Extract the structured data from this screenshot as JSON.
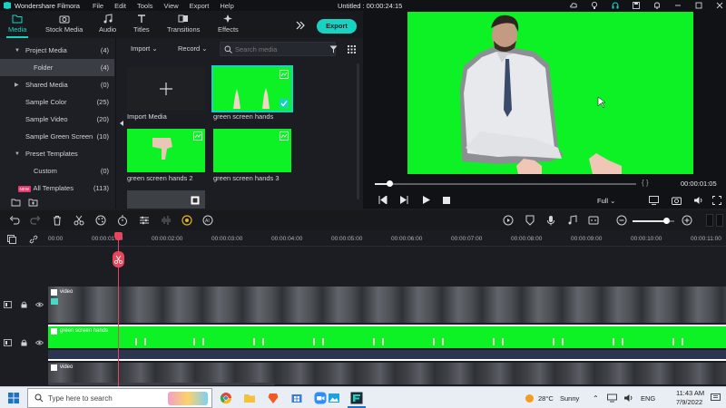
{
  "app": {
    "name": "Wondershare Filmora",
    "menu": [
      "File",
      "Edit",
      "Tools",
      "View",
      "Export",
      "Help"
    ],
    "document_title": "Untitled : 00:00:24:15"
  },
  "tabs": [
    {
      "label": "Media",
      "icon": "folder-icon"
    },
    {
      "label": "Stock Media",
      "icon": "camera-icon"
    },
    {
      "label": "Audio",
      "icon": "music-note-icon"
    },
    {
      "label": "Titles",
      "icon": "text-icon"
    },
    {
      "label": "Transitions",
      "icon": "transitions-icon"
    },
    {
      "label": "Effects",
      "icon": "effects-icon"
    }
  ],
  "export_label": "Export",
  "sidebar": {
    "items": [
      {
        "label": "Project Media",
        "count": "(4)",
        "caret": "▼"
      },
      {
        "label": "Folder",
        "count": "(4)"
      },
      {
        "label": "Shared Media",
        "count": "(0)",
        "caret": "▶"
      },
      {
        "label": "Sample Color",
        "count": "(25)"
      },
      {
        "label": "Sample Video",
        "count": "(20)"
      },
      {
        "label": "Sample Green Screen",
        "count": "(10)"
      },
      {
        "label": "Preset Templates",
        "count": "",
        "caret": "▼"
      },
      {
        "label": "Custom",
        "count": "(0)"
      },
      {
        "label": "All Templates",
        "count": "(113)",
        "badge": "NEW"
      }
    ]
  },
  "media_toolbar": {
    "import_label": "Import",
    "record_label": "Record",
    "search_placeholder": "Search media"
  },
  "media_items": [
    {
      "label": "Import Media"
    },
    {
      "label": "green screen hands"
    },
    {
      "label": "green screen hands 2"
    },
    {
      "label": "green screen hands 3"
    }
  ],
  "preview": {
    "brackets": "{  }",
    "time": "00:00:01:05",
    "quality": "Full"
  },
  "timeline": {
    "ruler": [
      "00:00",
      "00:00:01:00",
      "00:00:02:00",
      "00:00:03:00",
      "00:00:04:00",
      "00:00:05:00",
      "00:00:06:00",
      "00:00:07:00",
      "00:00:08:00",
      "00:00:09:00",
      "00:00:10:00",
      "00:00:11:00"
    ],
    "tracks": [
      {
        "name": "video"
      },
      {
        "name": "green screen hands"
      },
      {
        "name": "video"
      }
    ]
  },
  "taskbar": {
    "search_placeholder": "Type here to search",
    "weather_temp": "28°C",
    "weather_desc": "Sunny",
    "language": "ENG",
    "time": "11:43 AM",
    "date": "7/9/2022"
  },
  "colors": {
    "accent": "#19d3c2",
    "green_screen": "#0df224",
    "playhead": "#e8455c"
  }
}
